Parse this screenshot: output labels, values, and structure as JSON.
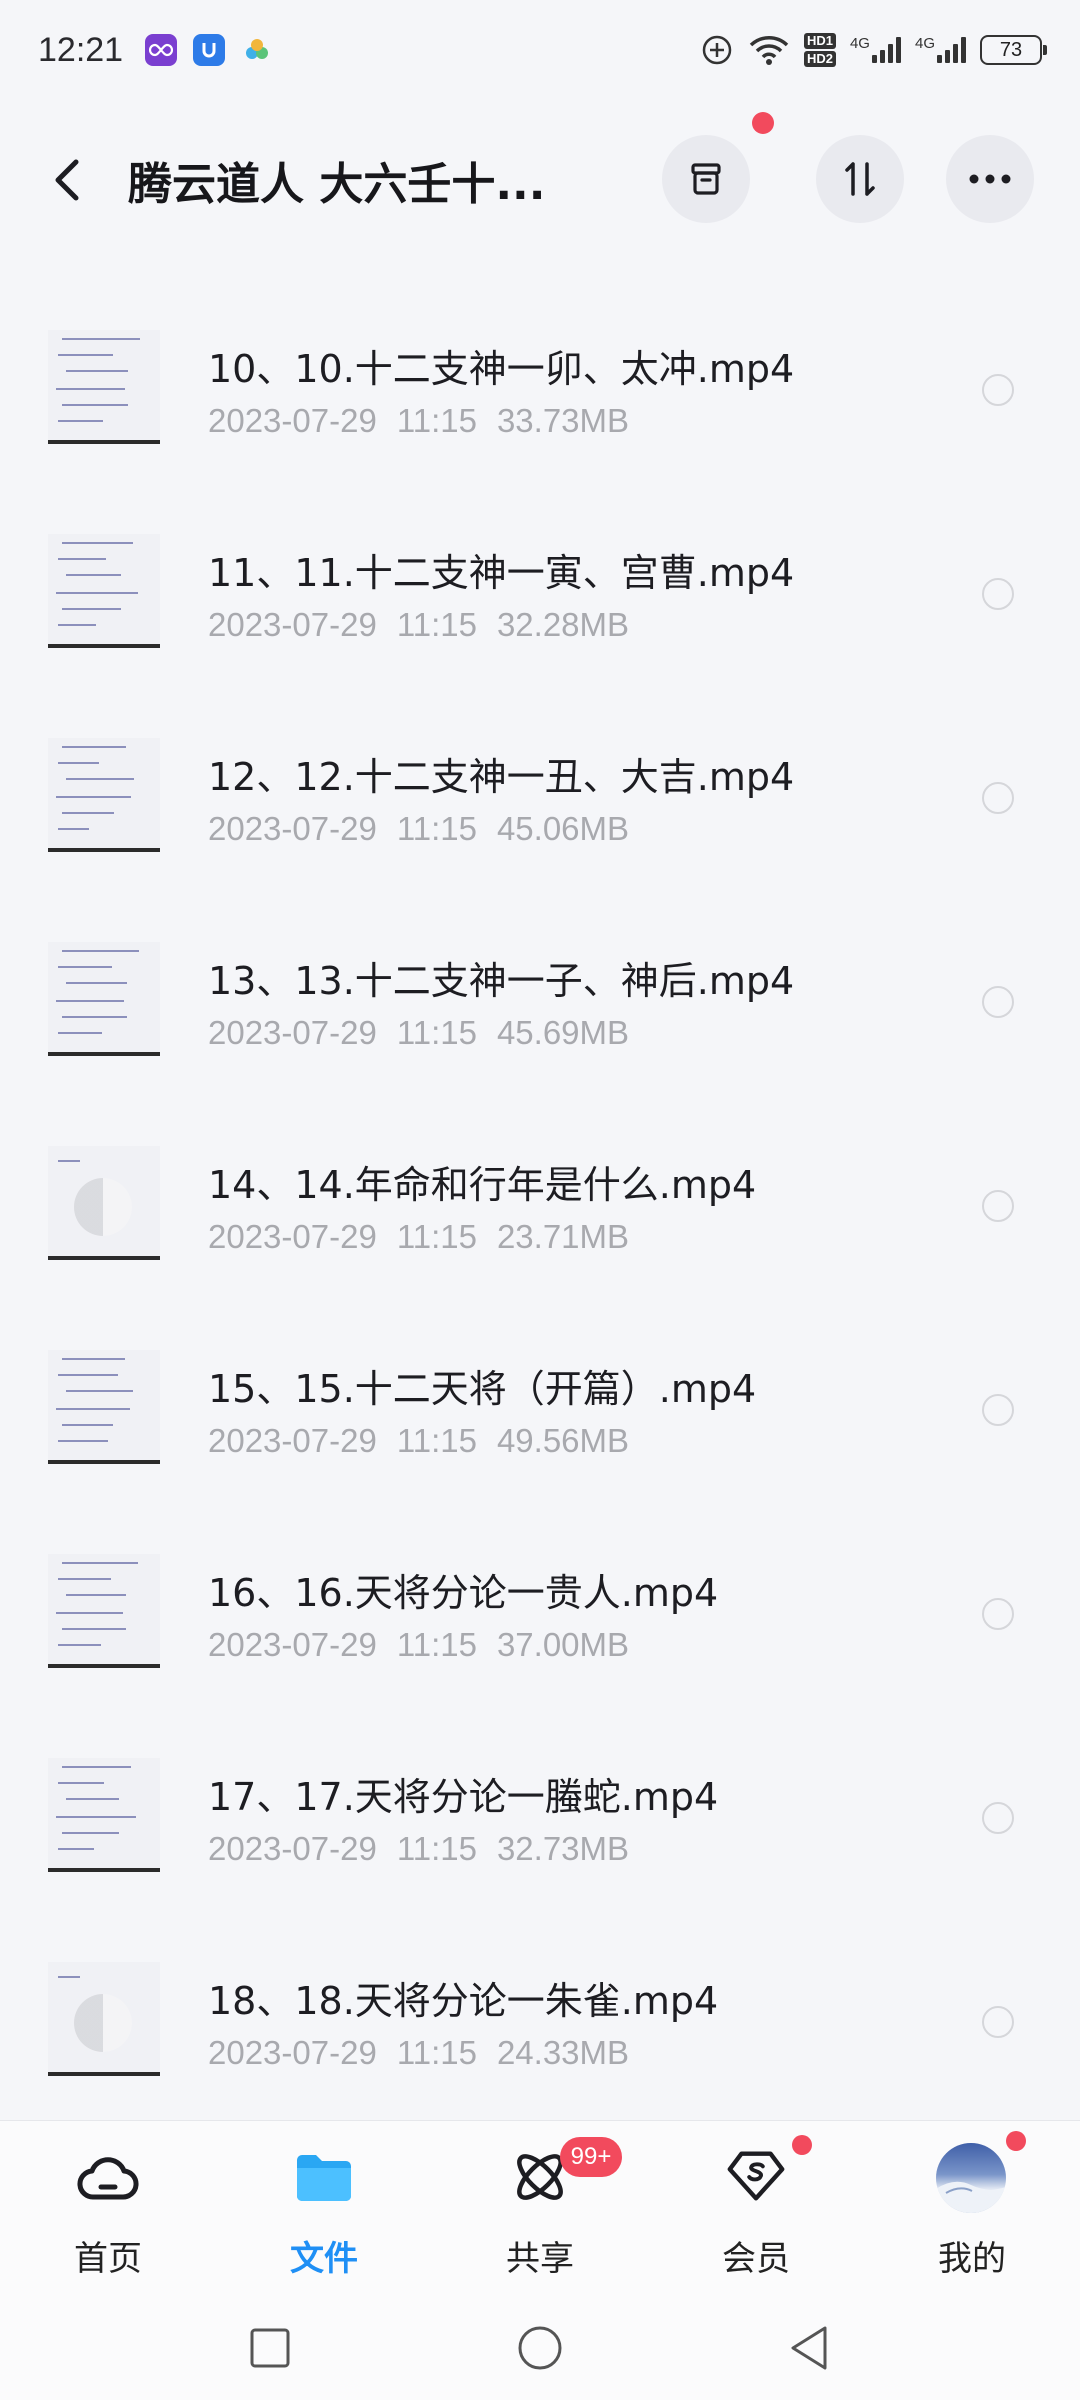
{
  "status_bar": {
    "time": "12:21",
    "app_icons": [
      "infinity-app-icon",
      "u-app-icon",
      "cloud-app-icon"
    ],
    "icons": [
      "add-circle-icon",
      "wifi-icon",
      "hd-icon",
      "signal-4g-icon",
      "signal-4g-icon",
      "battery-icon"
    ],
    "hd_top": "HD1",
    "hd_bottom": "HD2",
    "net1": "4G",
    "net2": "4G",
    "battery": "73"
  },
  "header": {
    "title": "腾云道人 大六壬十...",
    "back_icon": "chevron-left-icon",
    "buttons": [
      "trash-icon",
      "sort-icon",
      "more-icon"
    ],
    "notification_dot_color": "#f24a5d"
  },
  "files": [
    {
      "name": "10、10.十二支神一卯、太冲.mp4",
      "date": "2023-07-29",
      "time": "11:15",
      "size": "33.73MB",
      "thumb": "handwriting"
    },
    {
      "name": "11、11.十二支神一寅、宫曹.mp4",
      "date": "2023-07-29",
      "time": "11:15",
      "size": "32.28MB",
      "thumb": "handwriting"
    },
    {
      "name": "12、12.十二支神一丑、大吉.mp4",
      "date": "2023-07-29",
      "time": "11:15",
      "size": "45.06MB",
      "thumb": "handwriting"
    },
    {
      "name": "13、13.十二支神一子、神后.mp4",
      "date": "2023-07-29",
      "time": "11:15",
      "size": "45.69MB",
      "thumb": "handwriting"
    },
    {
      "name": "14、14.年命和行年是什么.mp4",
      "date": "2023-07-29",
      "time": "11:15",
      "size": "23.71MB",
      "thumb": "yinyang"
    },
    {
      "name": "15、15.十二天将（开篇）.mp4",
      "date": "2023-07-29",
      "time": "11:15",
      "size": "49.56MB",
      "thumb": "handwriting"
    },
    {
      "name": "16、16.天将分论一贵人.mp4",
      "date": "2023-07-29",
      "time": "11:15",
      "size": "37.00MB",
      "thumb": "handwriting"
    },
    {
      "name": "17、17.天将分论一螣蛇.mp4",
      "date": "2023-07-29",
      "time": "11:15",
      "size": "32.73MB",
      "thumb": "handwriting"
    },
    {
      "name": "18、18.天将分论一朱雀.mp4",
      "date": "2023-07-29",
      "time": "11:15",
      "size": "24.33MB",
      "thumb": "yinyang"
    }
  ],
  "bottom_nav": {
    "items": [
      {
        "label": "首页",
        "icon": "cloud-home-icon"
      },
      {
        "label": "文件",
        "icon": "folder-icon",
        "active": true
      },
      {
        "label": "共享",
        "icon": "atom-share-icon",
        "badge": "99+"
      },
      {
        "label": "会员",
        "icon": "vip-s-icon",
        "dot": true
      },
      {
        "label": "我的",
        "icon": "avatar",
        "dot": true
      }
    ],
    "active_color": "#1f8ff5",
    "badge_color": "#f24a5d"
  },
  "system_nav": [
    "recents-square-icon",
    "home-circle-icon",
    "back-triangle-icon"
  ]
}
